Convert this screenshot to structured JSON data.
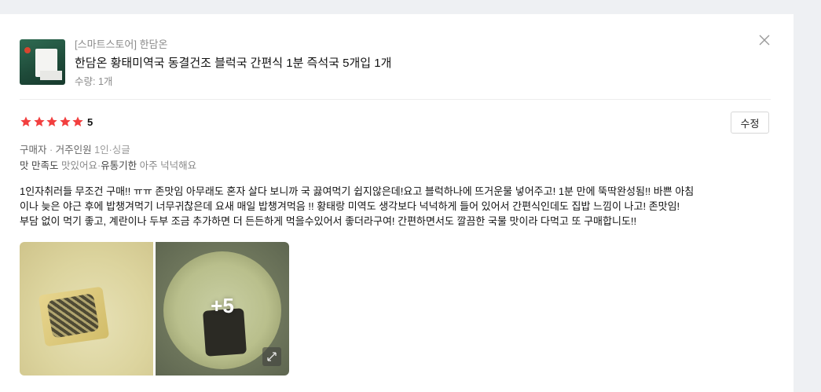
{
  "product": {
    "store": "[스마트스토어] 한담온",
    "title": "한담온 황태미역국 동결건조 블럭국 간편식 1분 즉석국 5개입 1개",
    "quantity": "수량: 1개"
  },
  "rating": {
    "stars": 5,
    "score": "5",
    "star_color": "#f23f3f"
  },
  "actions": {
    "edit_label": "수정"
  },
  "buyer": {
    "label": "구매자",
    "sep": "·",
    "household_label": "거주인원",
    "household_value": "1인",
    "household_value2": "싱글"
  },
  "satisfaction": {
    "taste_label": "맛 만족도",
    "taste_value": "맛있어요",
    "expiry_label": "유통기한",
    "expiry_value": "아주 넉넉해요"
  },
  "review": {
    "line1": "1인자취러들 무조건 구매!! ㅠㅠ 존맛임 아무래도 혼자 살다 보니까 국 끓여먹기 쉽지않은데!요고 블럭하나에 뜨거운물 넣어주고! 1분 만에 뚝딱완성됨!! 바쁜 아침",
    "line2": "이나 늦은 야근 후에 밥챙겨먹기 너무귀찮은데 요새 매일 밥챙겨먹음 !! 황태랑 미역도 생각보다 넉넉하게 들어 있어서 간편식인데도 집밥 느낌이 나고! 존맛임!",
    "line3": "부담 없이 먹기 좋고, 계란이나 두부 조금 추가하면 더 든든하게 먹을수있어서 좋더라구여! 간편하면서도 깔끔한 국물 맛이라 다먹고 또 구매합니도!!"
  },
  "photos": {
    "more_count": "+5"
  },
  "icons": {
    "close": "close-icon",
    "star": "star-icon",
    "expand": "expand-icon"
  }
}
